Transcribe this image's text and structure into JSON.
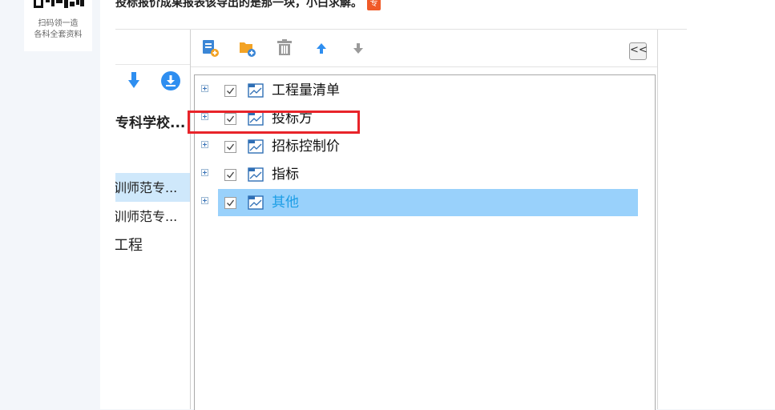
{
  "sidebar_card": {
    "qr_caption_line1": "扫码领一造",
    "qr_caption_line2": "各科全套资料"
  },
  "post": {
    "question": "投标报价成果报表该导出的是那一块，小白求解。",
    "tag": "专"
  },
  "left_panel": {
    "items": [
      {
        "label": "专科学校..."
      },
      {
        "label": "训师范专..."
      },
      {
        "label": "训师范专..."
      },
      {
        "label": "工程"
      }
    ]
  },
  "toolbar": {
    "tools": [
      "add-report-icon",
      "add-folder-icon",
      "delete-icon",
      "move-up-icon",
      "move-down-icon"
    ],
    "collapse_label": "<<"
  },
  "tree": {
    "items": [
      {
        "label": "工程量清单",
        "checked": true
      },
      {
        "label": "投标方",
        "checked": true
      },
      {
        "label": "招标控制价",
        "checked": true
      },
      {
        "label": "指标",
        "checked": true
      },
      {
        "label": "其他",
        "checked": true,
        "selected": true
      }
    ]
  },
  "colors": {
    "accent": "#2e8ef0",
    "selection": "#99d1fb",
    "selected_text": "#1d9ee6",
    "highlight_box": "#e8242a",
    "tag": "#f05a28"
  }
}
